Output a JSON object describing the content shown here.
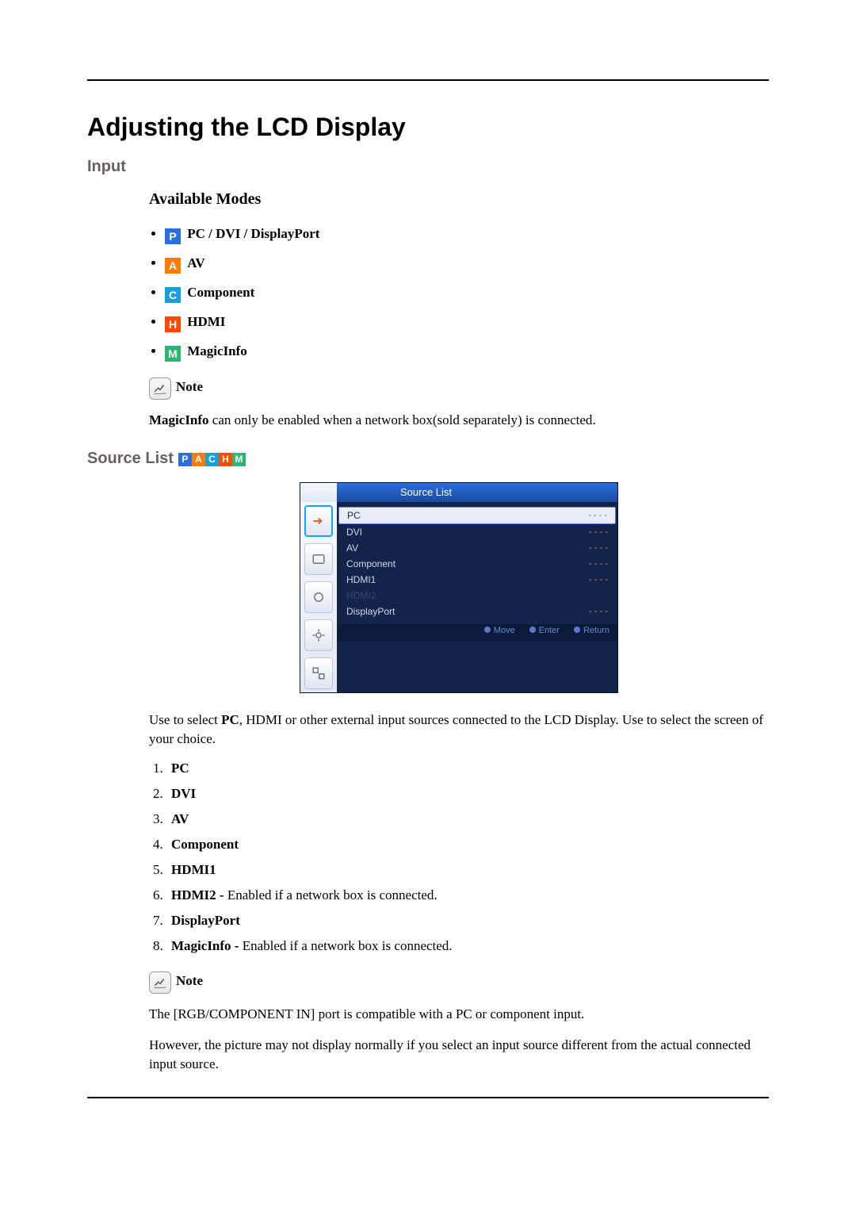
{
  "title": "Adjusting the LCD Display",
  "section_input": "Input",
  "available_modes_heading": "Available Modes",
  "modes": {
    "pc": "PC / DVI / DisplayPort",
    "av": "AV",
    "component": "Component",
    "hdmi": "HDMI",
    "magicinfo": "MagicInfo"
  },
  "note_label": "Note",
  "note1_bold": "MagicInfo",
  "note1_rest": " can only be enabled when a network box(sold separately) is connected.",
  "source_list_heading": "Source List",
  "osd": {
    "title": "Source List",
    "rows": [
      {
        "label": "PC",
        "status": "- - - -",
        "selected": true
      },
      {
        "label": "DVI",
        "status": "- - - -"
      },
      {
        "label": "AV",
        "status": "- - - -"
      },
      {
        "label": "Component",
        "status": "- - - -"
      },
      {
        "label": "HDMI1",
        "status": "- - - -"
      },
      {
        "label": "HDMI2",
        "status": "",
        "disabled": true
      },
      {
        "label": "DisplayPort",
        "status": "- - - -"
      }
    ],
    "footer": {
      "move": "Move",
      "enter": "Enter",
      "return": "Return"
    }
  },
  "source_list_para1_pre": "Use to select ",
  "source_list_para1_bold": "PC",
  "source_list_para1_post": ", HDMI or other external input sources connected to the LCD Display. Use to select the screen of your choice.",
  "source_items": [
    {
      "name": "PC",
      "extra": ""
    },
    {
      "name": "DVI",
      "extra": ""
    },
    {
      "name": "AV",
      "extra": ""
    },
    {
      "name": "Component",
      "extra": ""
    },
    {
      "name": "HDMI1",
      "extra": ""
    },
    {
      "name": "HDMI2 - ",
      "extra": "Enabled if a network box is connected."
    },
    {
      "name": "DisplayPort",
      "extra": ""
    },
    {
      "name": "MagicInfo - ",
      "extra": "Enabled if a network box is connected."
    }
  ],
  "note2_para1": "The [RGB/COMPONENT IN] port is compatible with a PC or component input.",
  "note2_para2": "However, the picture may not display normally if you select an input source different from the actual connected input source."
}
